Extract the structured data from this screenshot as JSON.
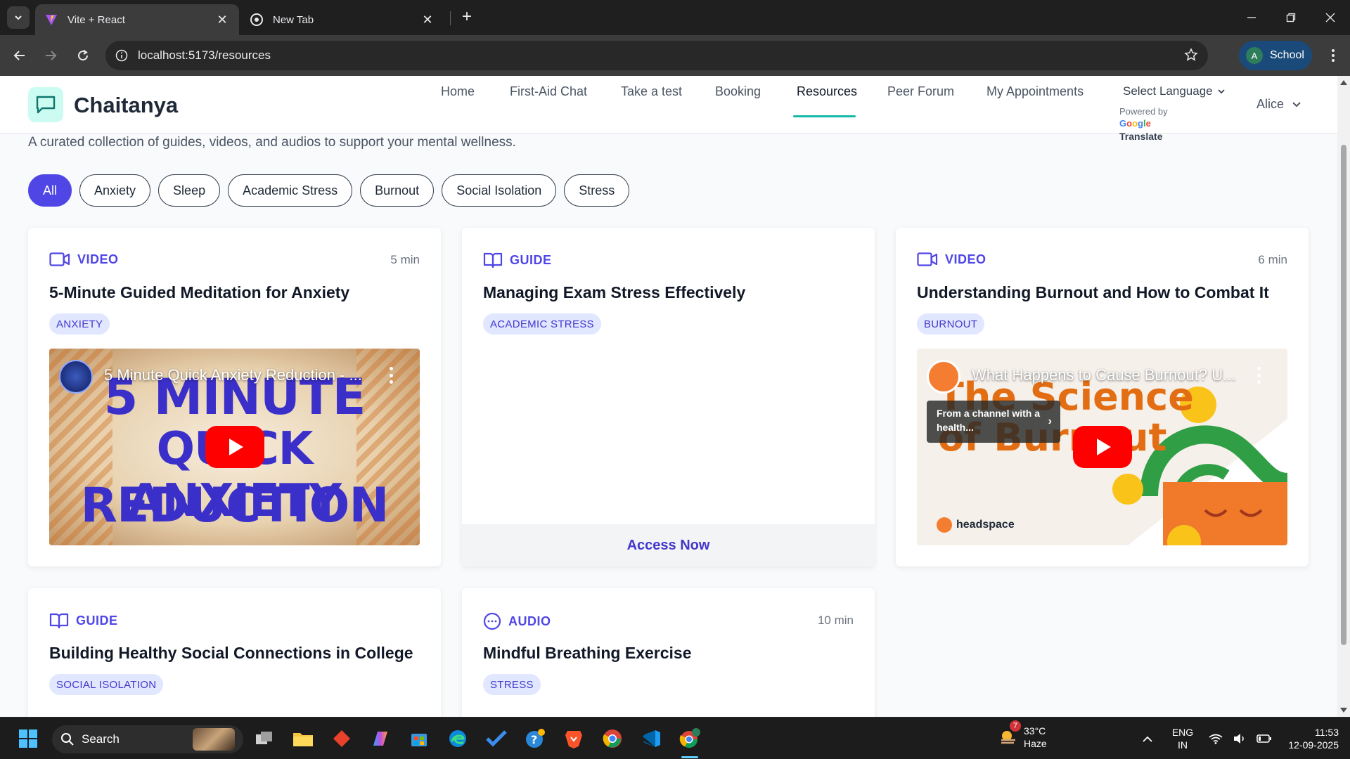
{
  "browser": {
    "tabs": [
      {
        "title": "Vite + React",
        "active": true,
        "favicon": "vite-icon"
      },
      {
        "title": "New Tab",
        "active": false,
        "favicon": "chrome-icon"
      }
    ],
    "url": "localhost:5173/resources",
    "profile": {
      "initial": "A",
      "name": "School"
    }
  },
  "site": {
    "brand": "Chaitanya",
    "nav": [
      {
        "label": "Home",
        "active": false
      },
      {
        "label": "First-Aid Chat",
        "active": false
      },
      {
        "label": "Take a test",
        "active": false
      },
      {
        "label": "Booking",
        "active": false
      },
      {
        "label": "Resources",
        "active": true
      },
      {
        "label": "Peer Forum",
        "active": false
      },
      {
        "label": "My Appointments",
        "active": false
      }
    ],
    "language": {
      "label": "Select Language",
      "powered_by": "Powered by",
      "google": "Google",
      "translate": "Translate"
    },
    "user": "Alice"
  },
  "page": {
    "subtitle": "A curated collection of guides, videos, and audios to support your mental wellness.",
    "filters": [
      "All",
      "Anxiety",
      "Sleep",
      "Academic Stress",
      "Burnout",
      "Social Isolation",
      "Stress"
    ],
    "active_filter": "All"
  },
  "cards": [
    {
      "type": "VIDEO",
      "icon": "video-icon",
      "duration": "5 min",
      "title": "5-Minute Guided Meditation for Anxiety",
      "tag": "ANXIETY",
      "video": {
        "title": "5 Minute Quick Anxiety Reduction - ...",
        "thumb_lines": [
          "5 MINUTE",
          "QUICK ANXIETY",
          "REDUCTION"
        ]
      }
    },
    {
      "type": "GUIDE",
      "icon": "book-icon",
      "duration": "",
      "title": "Managing Exam Stress Effectively",
      "tag": "ACADEMIC STRESS",
      "action": "Access Now"
    },
    {
      "type": "VIDEO",
      "icon": "video-icon",
      "duration": "6 min",
      "title": "Understanding Burnout and How to Combat It",
      "tag": "BURNOUT",
      "video": {
        "title": "What Happens to Cause Burnout? U...",
        "thumb_lines": [
          "The Science",
          "of Burnout"
        ],
        "channel_notice": "From a channel with a health...",
        "brand": "headspace"
      }
    },
    {
      "type": "GUIDE",
      "icon": "book-icon",
      "duration": "",
      "title": "Building Healthy Social Connections in College",
      "tag": "SOCIAL ISOLATION"
    },
    {
      "type": "AUDIO",
      "icon": "audio-icon",
      "duration": "10 min",
      "title": "Mindful Breathing Exercise",
      "tag": "STRESS"
    }
  ],
  "taskbar": {
    "search_label": "Search",
    "weather": {
      "temp": "33°C",
      "condition": "Haze",
      "badge": "7"
    },
    "lang": {
      "line1": "ENG",
      "line2": "IN"
    },
    "clock": {
      "time": "11:53",
      "date": "12-09-2025"
    },
    "apps": [
      "task-view-icon",
      "file-explorer-icon",
      "app-icon",
      "copilot-icon",
      "store-icon",
      "edge-icon",
      "todo-icon",
      "help-icon",
      "brave-icon",
      "chrome-icon",
      "vscode-icon",
      "chrome-profile-icon"
    ]
  },
  "colors": {
    "accent": "#4f46e5",
    "teal": "#14b8a6",
    "tag_bg": "#e0e7ff",
    "tag_text": "#4338ca"
  }
}
